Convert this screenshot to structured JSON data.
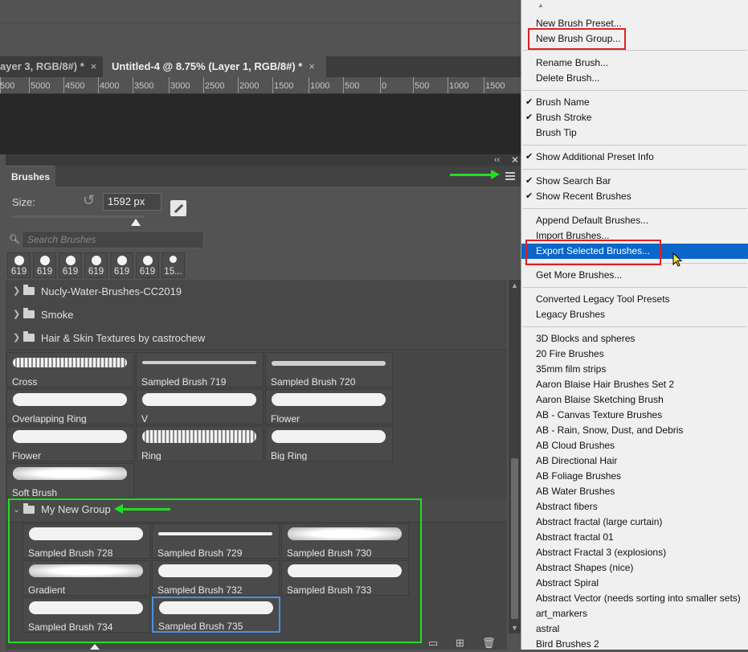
{
  "tabs": [
    {
      "label": "ayer 3, RGB/8#) *",
      "close": "×"
    },
    {
      "label": "Untitled-4 @ 8.75% (Layer 1, RGB/8#) *",
      "close": "×"
    }
  ],
  "ruler_labels": [
    "500",
    "5000",
    "4500",
    "4000",
    "3500",
    "3000",
    "2500",
    "2000",
    "1500",
    "1000",
    "500",
    "0",
    "500",
    "1000",
    "1500"
  ],
  "panel": {
    "tab_label": "Brushes",
    "size_label": "Size:",
    "size_value": "1592 px",
    "search_placeholder": "Search Brushes",
    "recent": [
      "619",
      "619",
      "619",
      "619",
      "619",
      "619",
      "15..."
    ],
    "groups": [
      "Nucly-Water-Brushes-CC2019",
      "Smoke",
      "Hair & Skin Textures by castrochew"
    ],
    "brushes": [
      "Cross",
      "Sampled Brush 719",
      "Sampled Brush 720",
      "Overlapping Ring",
      "V",
      "Flower",
      "Flower",
      "Ring",
      "Big Ring",
      "Soft Brush"
    ],
    "new_group": {
      "name": "My New Group",
      "brushes": [
        "Sampled Brush 728",
        "Sampled Brush 729",
        "Sampled Brush 730",
        "Gradient",
        "Sampled Brush 732",
        "Sampled Brush 733",
        "Sampled Brush 734",
        "Sampled Brush 735"
      ]
    }
  },
  "menu": {
    "items": [
      {
        "label": "New Brush Preset...",
        "check": ""
      },
      {
        "label": "New Brush Group...",
        "check": ""
      },
      {
        "label": "Rename Brush...",
        "check": ""
      },
      {
        "label": "Delete Brush...",
        "check": ""
      },
      {
        "label": "Brush Name",
        "check": "✔"
      },
      {
        "label": "Brush Stroke",
        "check": "✔"
      },
      {
        "label": "Brush Tip",
        "check": ""
      },
      {
        "label": "Show Additional Preset Info",
        "check": "✔"
      },
      {
        "label": "Show Search Bar",
        "check": "✔"
      },
      {
        "label": "Show Recent Brushes",
        "check": "✔"
      },
      {
        "label": "Append Default Brushes...",
        "check": ""
      },
      {
        "label": "Import Brushes...",
        "check": ""
      },
      {
        "label": "Export Selected Brushes...",
        "check": ""
      },
      {
        "label": "Get More Brushes...",
        "check": ""
      },
      {
        "label": "Converted Legacy Tool Presets",
        "check": ""
      },
      {
        "label": "Legacy Brushes",
        "check": ""
      },
      {
        "label": "3D Blocks and spheres",
        "check": ""
      },
      {
        "label": "20 Fire Brushes",
        "check": ""
      },
      {
        "label": "35mm film strips",
        "check": ""
      },
      {
        "label": "Aaron Blaise Hair Brushes Set 2",
        "check": ""
      },
      {
        "label": "Aaron Blaise Sketching Brush",
        "check": ""
      },
      {
        "label": "AB - Canvas Texture Brushes",
        "check": ""
      },
      {
        "label": "AB - Rain, Snow, Dust, and Debris",
        "check": ""
      },
      {
        "label": "AB Cloud Brushes",
        "check": ""
      },
      {
        "label": "AB Directional Hair",
        "check": ""
      },
      {
        "label": "AB Foliage Brushes",
        "check": ""
      },
      {
        "label": "AB Water Brushes",
        "check": ""
      },
      {
        "label": "Abstract fibers",
        "check": ""
      },
      {
        "label": "Abstract fractal (large curtain)",
        "check": ""
      },
      {
        "label": "Abstract fractal 01",
        "check": ""
      },
      {
        "label": "Abstract Fractal 3 (explosions)",
        "check": ""
      },
      {
        "label": "Abstract Shapes (nice)",
        "check": ""
      },
      {
        "label": "Abstract Spiral",
        "check": ""
      },
      {
        "label": "Abstract Vector (needs sorting into smaller sets)",
        "check": ""
      },
      {
        "label": "art_markers",
        "check": ""
      },
      {
        "label": "astral",
        "check": ""
      },
      {
        "label": "Bird Brushes 2",
        "check": ""
      }
    ]
  },
  "colors": {
    "highlight": "#0a66c9",
    "annotation_red": "#e02020",
    "annotation_green": "#22dd22",
    "selection_blue": "#4a90e2"
  }
}
